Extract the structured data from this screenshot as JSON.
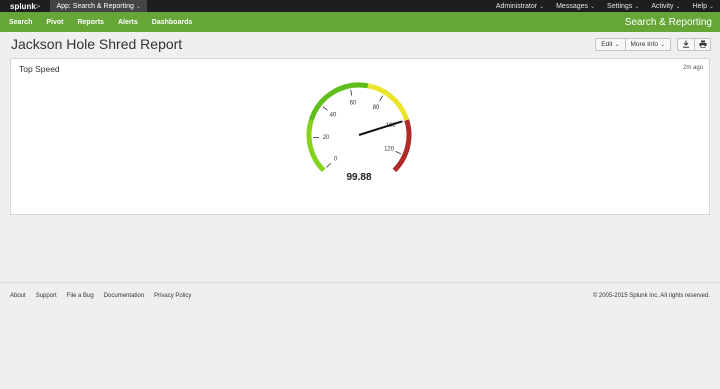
{
  "topbar": {
    "logo": "splunk",
    "logo_suffix": ">",
    "app_menu": "App: Search & Reporting",
    "items": [
      "Administrator",
      "Messages",
      "Settings",
      "Activity",
      "Help"
    ]
  },
  "nav": {
    "links": [
      "Search",
      "Pivot",
      "Reports",
      "Alerts",
      "Dashboards"
    ],
    "app_title": "Search & Reporting"
  },
  "page": {
    "title": "Jackson Hole Shred Report",
    "edit_label": "Edit",
    "more_info_label": "More Info"
  },
  "panel": {
    "title": "Top Speed",
    "time_ago": "2m ago"
  },
  "gauge": {
    "min": 0,
    "max": 130,
    "value": 99.88,
    "value_text": "99.88",
    "ticks": [
      "0",
      "20",
      "40",
      "60",
      "80",
      "100",
      "120"
    ],
    "tick_values": [
      0,
      20,
      40,
      60,
      80,
      100,
      120
    ],
    "ranges": [
      {
        "from": 0,
        "to": 30,
        "color": "#84d21b"
      },
      {
        "from": 30,
        "to": 70,
        "color": "#5fbe1a"
      },
      {
        "from": 70,
        "to": 100,
        "color": "#ebe42d"
      },
      {
        "from": 100,
        "to": 130,
        "color": "#b12a2a"
      }
    ],
    "needle_color": "#111111"
  },
  "footer": {
    "links": [
      "About",
      "Support",
      "File a Bug",
      "Documentation",
      "Privacy Policy"
    ],
    "copyright": "© 2005-2015 Splunk Inc. All rights reserved."
  }
}
